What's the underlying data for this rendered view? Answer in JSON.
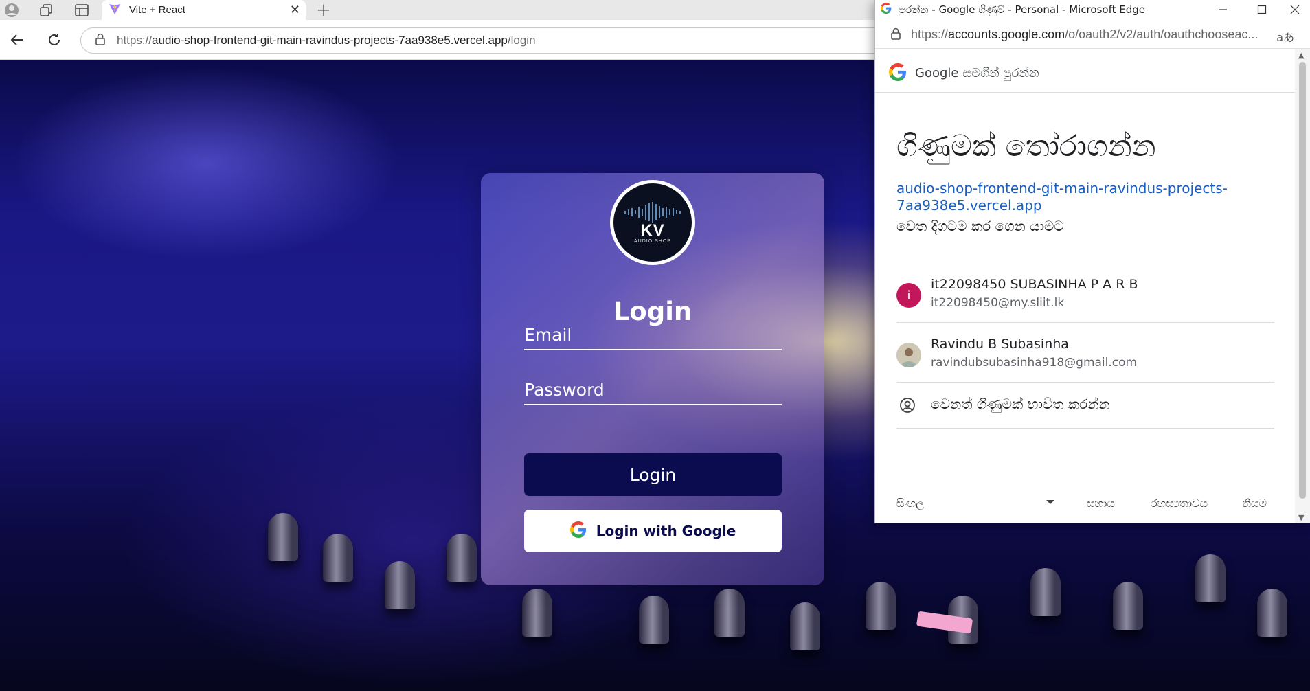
{
  "browser": {
    "tab_title": "Vite + React",
    "url_prefix": "https://",
    "url_host": "audio-shop-frontend-git-main-ravindus-projects-7aa938e5.vercel.app",
    "url_path": "/login"
  },
  "login": {
    "logo_text": "KV",
    "logo_sub": "AUDIO SHOP",
    "title": "Login",
    "email_placeholder": "Email",
    "password_placeholder": "Password",
    "login_button": "Login",
    "google_button": "Login with Google"
  },
  "popup": {
    "window_title": "පුරන්න - Google ගිණුම් - Personal - Microsoft Edge",
    "url_prefix": "https://",
    "url_host": "accounts.google.com",
    "url_path": "/o/oauth2/v2/auth/oauthchooseac...",
    "reader_icon_label": "aあ",
    "header": "Google සමගින් පුරන්න",
    "choose_title": "ගිණුමක් තෝරාගන්න",
    "continue_link": "audio-shop-frontend-git-main-ravindus-projects-7aa938e5.vercel.app",
    "continue_sub": "වෙත දිගටම කර ගෙන යාමට",
    "accounts": [
      {
        "initial": "i",
        "name": "it22098450 SUBASINHA P A R B",
        "email": "it22098450@my.sliit.lk",
        "avatar_color": "#c2185b"
      },
      {
        "initial": "",
        "name": "Ravindu B Subasinha",
        "email": "ravindubsubasinha918@gmail.com",
        "avatar_color": "#b9b4a5"
      }
    ],
    "use_another": "වෙනත් ගිණුමක් භාවිත කරන්න",
    "footer": {
      "language": "සිංහල",
      "help": "සහාය",
      "privacy": "රහස්‍යතාවය",
      "terms": "නියම"
    }
  },
  "colors": {
    "card_button": "#0b0b4f",
    "google_link": "#1a5fc1",
    "first_avatar": "#c2185b"
  }
}
